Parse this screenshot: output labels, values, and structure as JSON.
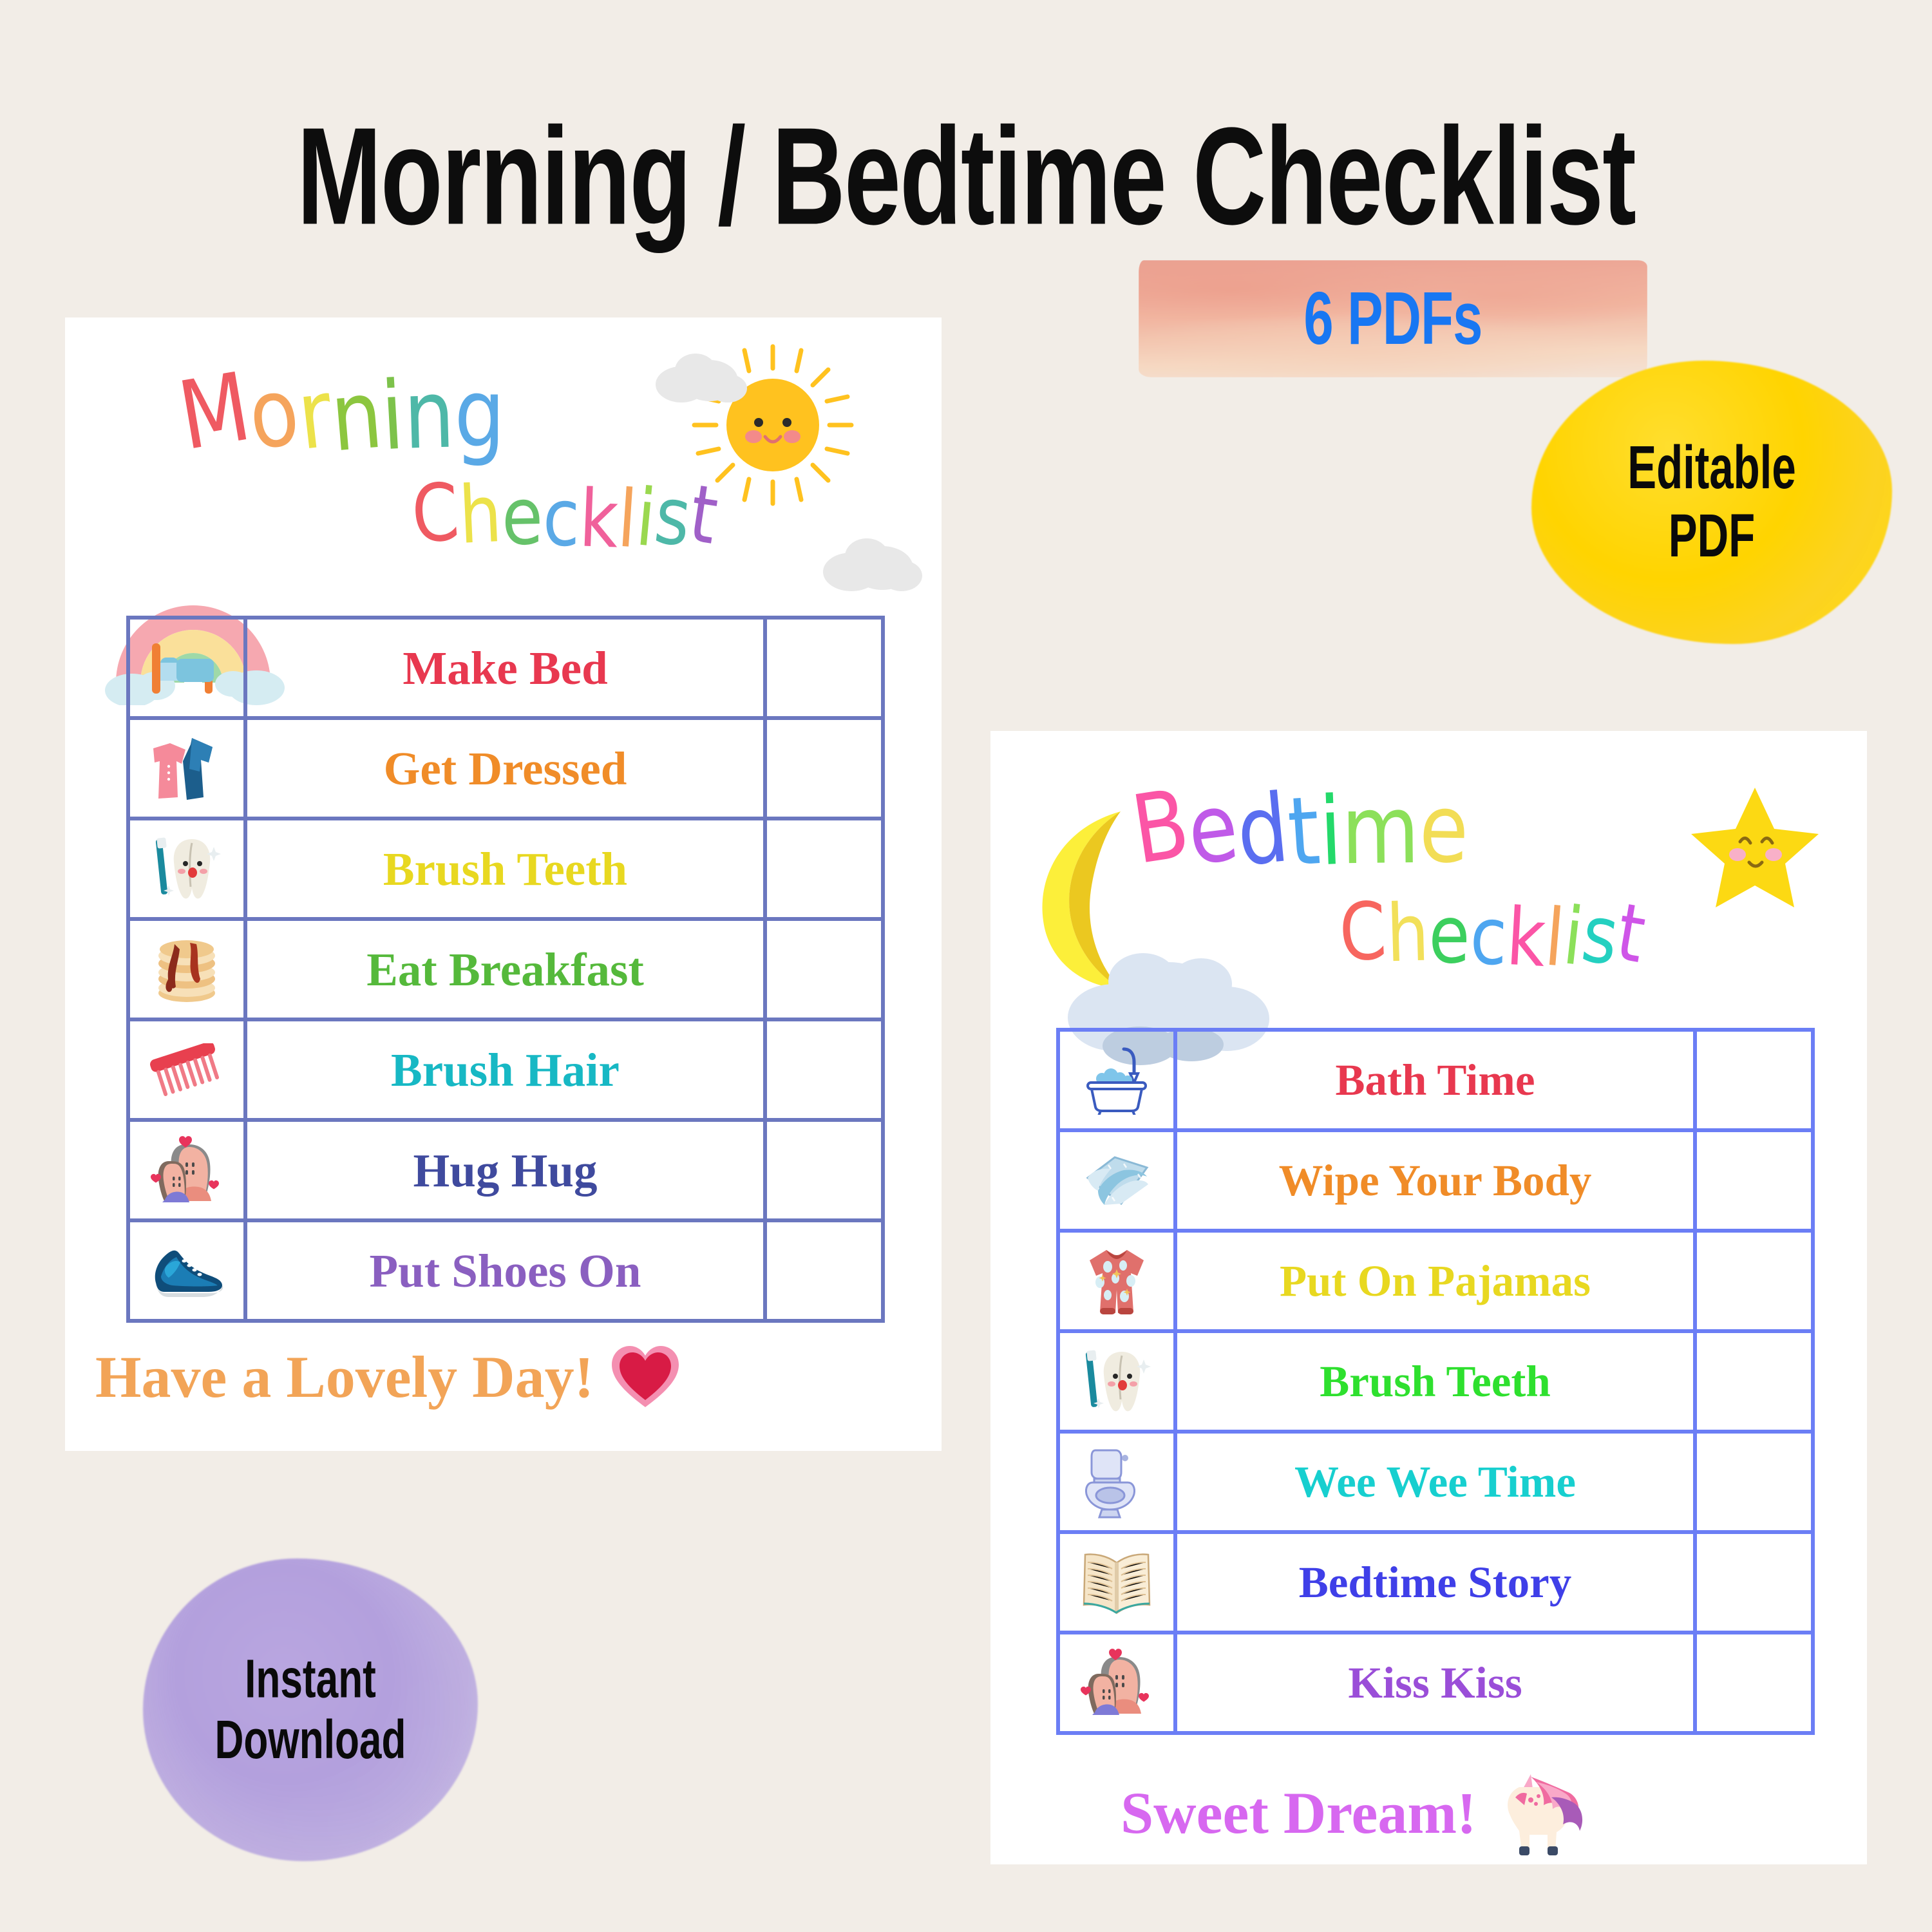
{
  "page": {
    "background_color": "#f2ede7",
    "main_title": "Morning / Bedtime Checklist"
  },
  "badges": {
    "pdfs": {
      "label": "6 PDFs",
      "text_color": "#1877f2",
      "swash_color": "#eb9d8d"
    },
    "editable": {
      "line1": "Editable",
      "line2": "PDF",
      "text_color": "#0a0a0a",
      "blot_color": "#ffd400"
    },
    "instant": {
      "line1": "Instant",
      "line2": "Download",
      "text_color": "#0a0a0a",
      "blot_color": "#b3a0dd"
    }
  },
  "morning_card": {
    "heading_line1": "Morning",
    "heading_line2": "Checklist",
    "heading_colors_line1": [
      "#ef5a62",
      "#f5a45c",
      "#ece24a",
      "#8cc63f",
      "#7dc24b",
      "#4eb8a8",
      "#5aa9e6"
    ],
    "heading_colors_line2": [
      "#ef5a62",
      "#ece24a",
      "#66c26a",
      "#5aa9e6",
      "#f0619b",
      "#f5a45c",
      "#9ad84f",
      "#4eb8a8",
      "#a060c8"
    ],
    "decor": [
      "rainbow",
      "sun",
      "cloud",
      "cloud"
    ],
    "border_color": "#6b77bf",
    "rows": [
      {
        "icon": "bed-icon",
        "label": "Make Bed",
        "color": "#e8384f",
        "check": ""
      },
      {
        "icon": "clothes-icon",
        "label": "Get Dressed",
        "color": "#f08c28",
        "check": ""
      },
      {
        "icon": "tooth-brush-icon",
        "label": "Brush Teeth",
        "color": "#e8d820",
        "check": ""
      },
      {
        "icon": "pancakes-icon",
        "label": "Eat Breakfast",
        "color": "#55b93b",
        "check": ""
      },
      {
        "icon": "comb-icon",
        "label": "Brush Hair",
        "color": "#17b8c4",
        "check": ""
      },
      {
        "icon": "hug-icon",
        "label": "Hug Hug",
        "color": "#3f4a9e",
        "check": ""
      },
      {
        "icon": "shoes-icon",
        "label": "Put Shoes On",
        "color": "#8a5fc0",
        "check": ""
      }
    ],
    "footer": {
      "text": "Have a Lovely Day!",
      "color": "#f2a457",
      "icon": "heart-icon"
    }
  },
  "bedtime_card": {
    "heading_line1": "Bedtime",
    "heading_line2": "Checklist",
    "heading_colors_line1": [
      "#fb55a6",
      "#c05ae8",
      "#5a6ef0",
      "#4ea6f0",
      "#24d96a",
      "#8ce05a",
      "#f2dd55"
    ],
    "heading_colors_line2": [
      "#f7665f",
      "#f2e05a",
      "#3ccf5e",
      "#4ea6f0",
      "#fb55a6",
      "#f5a45c",
      "#8ce05a",
      "#24d0c0",
      "#cf55e8"
    ],
    "decor": [
      "moon",
      "cloud",
      "star"
    ],
    "border_color": "#6b7ef5",
    "rows": [
      {
        "icon": "bathtub-icon",
        "label": "Bath Time",
        "color": "#e8384f",
        "check": ""
      },
      {
        "icon": "towel-icon",
        "label": "Wipe Your Body",
        "color": "#f08c28",
        "check": ""
      },
      {
        "icon": "pajamas-icon",
        "label": "Put On Pajamas",
        "color": "#e8d820",
        "check": ""
      },
      {
        "icon": "tooth-brush-icon",
        "label": "Brush Teeth",
        "color": "#2ee02e",
        "check": ""
      },
      {
        "icon": "toilet-icon",
        "label": "Wee Wee Time",
        "color": "#17cfcf",
        "check": ""
      },
      {
        "icon": "book-icon",
        "label": "Bedtime Story",
        "color": "#3f3fe8",
        "check": ""
      },
      {
        "icon": "hug-icon",
        "label": "Kiss Kiss",
        "color": "#9a4ed8",
        "check": ""
      }
    ],
    "footer": {
      "text": "Sweet Dream!",
      "color": "#d768f0",
      "icon": "unicorn-icon"
    }
  }
}
